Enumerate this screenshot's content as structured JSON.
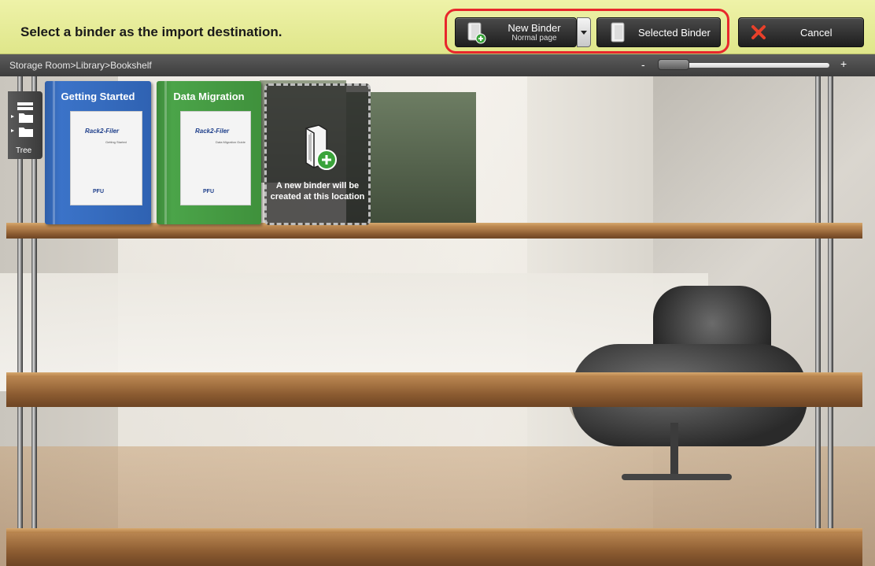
{
  "topbar": {
    "instruction": "Select a binder as the import destination.",
    "new_binder_label": "New Binder",
    "new_binder_sublabel": "Normal page",
    "selected_binder_label": "Selected Binder",
    "cancel_label": "Cancel"
  },
  "breadcrumb": {
    "path": "Storage Room>Library>Bookshelf"
  },
  "zoom": {
    "minus": "-",
    "plus": "+",
    "level": 0.1
  },
  "tree_tab": {
    "label": "Tree"
  },
  "binders": [
    {
      "title": "Getting Started",
      "logo": "Rack2-Filer",
      "sub": "Getting Started",
      "foot": "PFU",
      "color": "#3b73c8"
    },
    {
      "title": "Data Migration",
      "logo": "Rack2-Filer",
      "sub": "Data Migration Guide",
      "foot": "PFU",
      "color": "#4ba449"
    }
  ],
  "new_binder_slot": {
    "message_line1": "A new binder will be",
    "message_line2": "created at this location"
  },
  "colors": {
    "highlight": "#e8272c",
    "topbar": "#e6ec96",
    "cancel_x": "#e8402a"
  }
}
